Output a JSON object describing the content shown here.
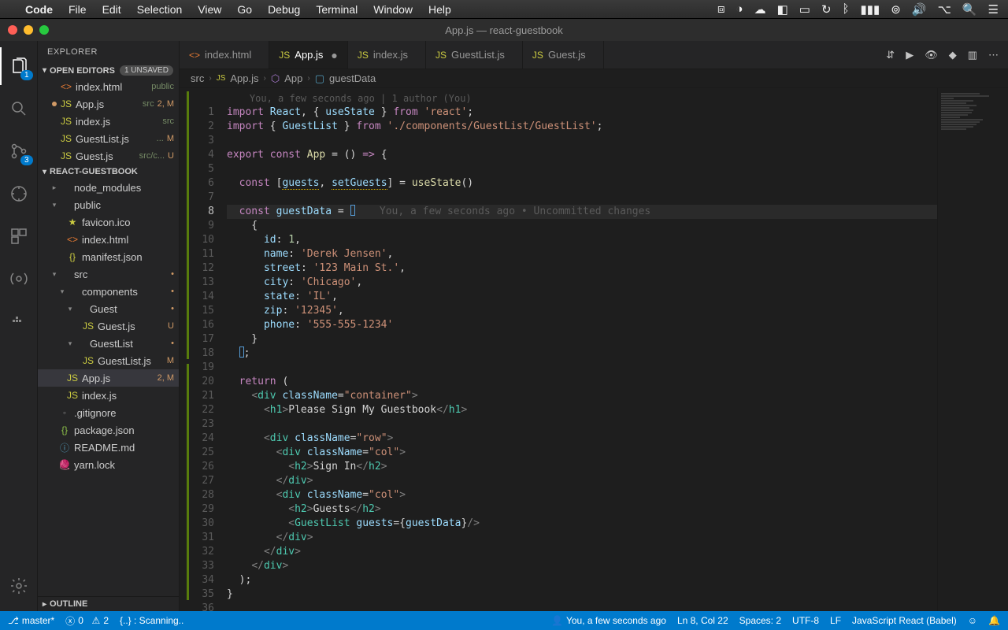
{
  "menubar": {
    "app_name": "Code",
    "items": [
      "File",
      "Edit",
      "Selection",
      "View",
      "Go",
      "Debug",
      "Terminal",
      "Window",
      "Help"
    ]
  },
  "window": {
    "title": "App.js — react-guestbook"
  },
  "activitybar": {
    "explorer_badge": "1",
    "scm_badge": "3"
  },
  "sidebar": {
    "title": "EXPLORER",
    "open_editors": {
      "label": "OPEN EDITORS",
      "unsaved_pill": "1 UNSAVED",
      "items": [
        {
          "icon": "<>",
          "iconClass": "ic-orange",
          "name": "index.html",
          "meta": "public",
          "status": ""
        },
        {
          "icon": "JS",
          "iconClass": "ic-yellow",
          "name": "App.js",
          "meta": "src",
          "status": "2, M",
          "dot": true
        },
        {
          "icon": "JS",
          "iconClass": "ic-yellow",
          "name": "index.js",
          "meta": "src",
          "status": ""
        },
        {
          "icon": "JS",
          "iconClass": "ic-yellow",
          "name": "GuestList.js",
          "meta": "...",
          "status": "M"
        },
        {
          "icon": "JS",
          "iconClass": "ic-yellow",
          "name": "Guest.js",
          "meta": "src/c...",
          "status": "U"
        }
      ]
    },
    "project": {
      "label": "REACT-GUESTBOOK",
      "nodes": [
        {
          "depth": 1,
          "tw": "▸",
          "icon": "",
          "name": "node_modules",
          "meta": "",
          "status": "",
          "iconClass": "ic-grey"
        },
        {
          "depth": 1,
          "tw": "▾",
          "icon": "",
          "name": "public",
          "meta": "",
          "status": "",
          "iconClass": "ic-grey"
        },
        {
          "depth": 2,
          "tw": "",
          "icon": "★",
          "name": "favicon.ico",
          "meta": "",
          "status": "",
          "iconClass": "ic-yellow"
        },
        {
          "depth": 2,
          "tw": "",
          "icon": "<>",
          "name": "index.html",
          "meta": "",
          "status": "",
          "iconClass": "ic-orange"
        },
        {
          "depth": 2,
          "tw": "",
          "icon": "{}",
          "name": "manifest.json",
          "meta": "",
          "status": "",
          "iconClass": "ic-yellow"
        },
        {
          "depth": 1,
          "tw": "▾",
          "icon": "",
          "name": "src",
          "meta": "",
          "status": "•",
          "iconClass": "ic-grey"
        },
        {
          "depth": 2,
          "tw": "▾",
          "icon": "",
          "name": "components",
          "meta": "",
          "status": "•",
          "iconClass": "ic-grey"
        },
        {
          "depth": 3,
          "tw": "▾",
          "icon": "",
          "name": "Guest",
          "meta": "",
          "status": "•",
          "iconClass": "ic-grey"
        },
        {
          "depth": 4,
          "tw": "",
          "icon": "JS",
          "name": "Guest.js",
          "meta": "",
          "status": "U",
          "iconClass": "ic-yellow"
        },
        {
          "depth": 3,
          "tw": "▾",
          "icon": "",
          "name": "GuestList",
          "meta": "",
          "status": "•",
          "iconClass": "ic-grey"
        },
        {
          "depth": 4,
          "tw": "",
          "icon": "JS",
          "name": "GuestList.js",
          "meta": "",
          "status": "M",
          "iconClass": "ic-yellow"
        },
        {
          "depth": 2,
          "tw": "",
          "icon": "JS",
          "name": "App.js",
          "meta": "",
          "status": "2, M",
          "iconClass": "ic-yellow",
          "selected": true
        },
        {
          "depth": 2,
          "tw": "",
          "icon": "JS",
          "name": "index.js",
          "meta": "",
          "status": "",
          "iconClass": "ic-yellow"
        },
        {
          "depth": 1,
          "tw": "",
          "icon": "◦",
          "name": ".gitignore",
          "meta": "",
          "status": "",
          "iconClass": "ic-grey"
        },
        {
          "depth": 1,
          "tw": "",
          "icon": "{}",
          "name": "package.json",
          "meta": "",
          "status": "",
          "iconClass": "ic-green"
        },
        {
          "depth": 1,
          "tw": "",
          "icon": "ⓘ",
          "name": "README.md",
          "meta": "",
          "status": "",
          "iconClass": "ic-blue"
        },
        {
          "depth": 1,
          "tw": "",
          "icon": "🧶",
          "name": "yarn.lock",
          "meta": "",
          "status": "",
          "iconClass": "ic-grey"
        }
      ]
    },
    "outline_label": "OUTLINE"
  },
  "tabs": [
    {
      "icon": "<>",
      "iconClass": "ic-orange",
      "label": "index.html",
      "active": false
    },
    {
      "icon": "JS",
      "iconClass": "ic-yellow",
      "label": "App.js",
      "active": true,
      "dirty": true
    },
    {
      "icon": "JS",
      "iconClass": "ic-yellow",
      "label": "index.js",
      "active": false
    },
    {
      "icon": "JS",
      "iconClass": "ic-yellow",
      "label": "GuestList.js",
      "active": false
    },
    {
      "icon": "JS",
      "iconClass": "ic-yellow",
      "label": "Guest.js",
      "active": false
    }
  ],
  "breadcrumbs": [
    "src",
    "App.js",
    "App",
    "guestData"
  ],
  "editor": {
    "author_line": "You, a few seconds ago | 1 author (You)",
    "current_line": 8,
    "inline_blame": "You, a few seconds ago • Uncommitted changes",
    "code": {
      "1": {
        "t": "import React, { useState } from 'react';"
      },
      "2": {
        "t": "import { GuestList } from './components/GuestList/GuestList';"
      },
      "4": {
        "t": "export const App = () => {"
      },
      "6": {
        "t": "  const [guests, setGuests] = useState()"
      },
      "8": {
        "t": "  const guestData = ["
      },
      "9": {
        "t": "    {"
      },
      "10": {
        "t": "      id: 1,"
      },
      "11": {
        "t": "      name: 'Derek Jensen',"
      },
      "12": {
        "t": "      street: '123 Main St.',"
      },
      "13": {
        "t": "      city: 'Chicago',"
      },
      "14": {
        "t": "      state: 'IL',"
      },
      "15": {
        "t": "      zip: '12345',"
      },
      "16": {
        "t": "      phone: '555-555-1234'"
      },
      "17": {
        "t": "    }"
      },
      "18": {
        "t": "  ];"
      },
      "20": {
        "t": "  return ("
      },
      "21": {
        "t": "    <div className=\"container\">"
      },
      "22": {
        "t": "      <h1>Please Sign My Guestbook</h1>"
      },
      "24": {
        "t": "      <div className=\"row\">"
      },
      "25": {
        "t": "        <div className=\"col\">"
      },
      "26": {
        "t": "          <h2>Sign In</h2>"
      },
      "27": {
        "t": "        </div>"
      },
      "28": {
        "t": "        <div className=\"col\">"
      },
      "29": {
        "t": "          <h2>Guests</h2>"
      },
      "30": {
        "t": "          <GuestList guests={guestData}/>"
      },
      "31": {
        "t": "        </div>"
      },
      "32": {
        "t": "      </div>"
      },
      "33": {
        "t": "    </div>"
      },
      "34": {
        "t": "  );"
      },
      "35": {
        "t": "}"
      }
    }
  },
  "statusbar": {
    "branch": "master*",
    "errors": "0",
    "warnings": "2",
    "scan": "{..} : Scanning..",
    "blame": "You, a few seconds ago",
    "position": "Ln 8, Col 22",
    "spaces": "Spaces: 2",
    "encoding": "UTF-8",
    "eol": "LF",
    "language": "JavaScript React (Babel)"
  }
}
